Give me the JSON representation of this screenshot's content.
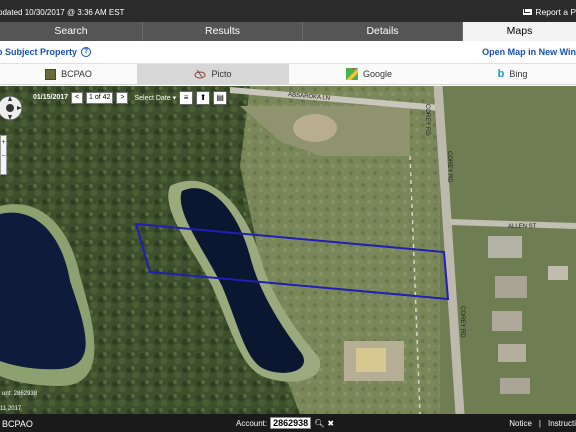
{
  "topbar": {
    "updated": "pdated 10/30/2017 @ 3:36 AM EST",
    "report": "Report a P"
  },
  "tabs": [
    {
      "label": "Search"
    },
    {
      "label": "Results"
    },
    {
      "label": "Details"
    },
    {
      "label": "Maps"
    }
  ],
  "subject": {
    "label": "o Subject Property",
    "help": "?",
    "open_map": "Open Map in New Win"
  },
  "providers": [
    {
      "label": "BCPAO",
      "icon": "bcpao-icon"
    },
    {
      "label": "Picto",
      "icon": "picto-icon"
    },
    {
      "label": "Google",
      "icon": "google-maps-icon"
    },
    {
      "label": "Bing",
      "icon": "bing-icon"
    }
  ],
  "map_controls": {
    "date": "01/15/2017",
    "page": "1 of 42",
    "select_date": "Select Date",
    "prev": "<",
    "next": ">"
  },
  "map_labels": {
    "absaroka": "ABSAROKA LN",
    "corey_top": "COREY RD",
    "corey_mid": "COREY RD",
    "corey_low": "COREY RD",
    "allen": "ALLEN ST",
    "account_overlay": "unt: 2862938",
    "year_overlay": "11 2017"
  },
  "bottom": {
    "brand": "BCPAO",
    "account_label": "Account:",
    "account_value": "2862938",
    "notice": "Notice",
    "instructions": "Instructi"
  },
  "colors": {
    "parcel_outline": "#1f1fb5",
    "tab_bg": "#555555",
    "link": "#1a4fb5"
  }
}
